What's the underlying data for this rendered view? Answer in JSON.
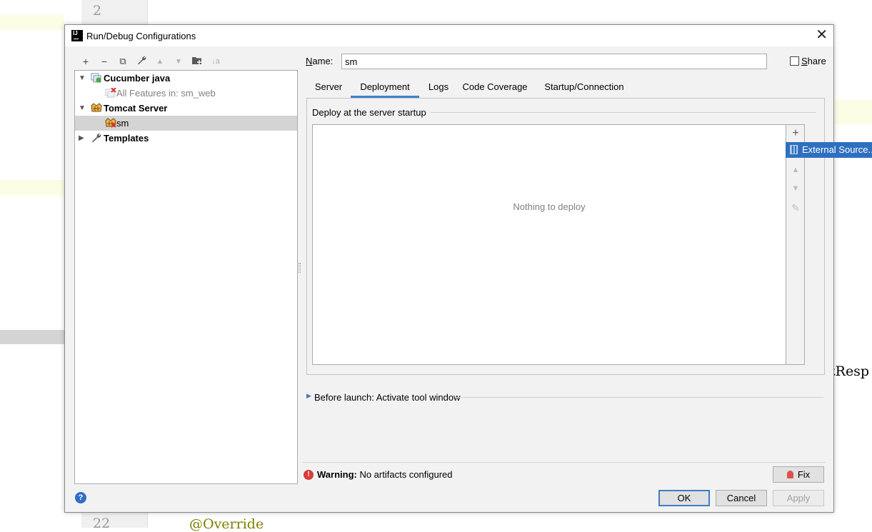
{
  "editor": {
    "line_top": "2",
    "line_bottom": "22",
    "code_right": "tResp",
    "code_bottom": "@Override"
  },
  "dialog": {
    "app_icon": "IJ",
    "title": "Run/Debug Configurations",
    "close_glyph": "✕"
  },
  "toolbar": {
    "add": "+",
    "remove": "−",
    "copy": "⧉",
    "edit": "🔧",
    "move_up": "▲",
    "move_down": "▼",
    "new_folder": "📁",
    "sort": "↓a"
  },
  "tree": [
    {
      "label": "Cucumber java",
      "icon": "cucumber-icon",
      "expanded": true
    },
    {
      "label": "All Features in: sm_web",
      "icon": "cucumber-error-icon"
    },
    {
      "label": "Tomcat Server",
      "icon": "tomcat-icon",
      "expanded": true
    },
    {
      "label": "sm",
      "icon": "tomcat-icon",
      "selected": true
    },
    {
      "label": "Templates",
      "icon": "wrench-icon",
      "expanded": false
    }
  ],
  "name_field": {
    "label": "Name:",
    "value": "sm"
  },
  "share": {
    "label": "Share",
    "checked": false
  },
  "tabs": [
    {
      "label": "Server"
    },
    {
      "label": "Deployment",
      "active": true
    },
    {
      "label": "Logs"
    },
    {
      "label": "Code Coverage"
    },
    {
      "label": "Startup/Connection"
    }
  ],
  "deploy": {
    "group_title": "Deploy at the server startup",
    "empty_text": "Nothing to deploy",
    "add_glyph": "+",
    "up_glyph": "▲",
    "down_glyph": "▼",
    "edit_glyph": "✎"
  },
  "popup": {
    "label": "External Source..."
  },
  "before_launch": {
    "arrow": "▶",
    "label": "Before launch: Activate tool window"
  },
  "warning": {
    "icon": "!",
    "prefix": "Warning:",
    "text": " No artifacts configured"
  },
  "buttons": {
    "fix": "Fix",
    "help": "?",
    "ok": "OK",
    "cancel": "Cancel",
    "apply": "Apply"
  },
  "colors": {
    "accent": "#4083c9",
    "selection": "#d4d4d4",
    "popup": "#2f6fbf",
    "error": "#db3b3b"
  }
}
